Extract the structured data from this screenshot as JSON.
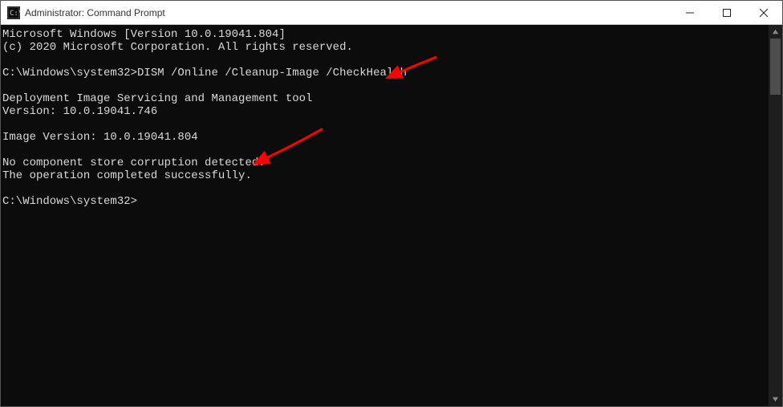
{
  "window": {
    "title": "Administrator: Command Prompt"
  },
  "terminal": {
    "lines": [
      "Microsoft Windows [Version 10.0.19041.804]",
      "(c) 2020 Microsoft Corporation. All rights reserved.",
      "",
      "C:\\Windows\\system32>DISM /Online /Cleanup-Image /CheckHealth",
      "",
      "Deployment Image Servicing and Management tool",
      "Version: 10.0.19041.746",
      "",
      "Image Version: 10.0.19041.804",
      "",
      "No component store corruption detected.",
      "The operation completed successfully.",
      "",
      "C:\\Windows\\system32>"
    ],
    "prompt": "C:\\Windows\\system32>",
    "command": "DISM /Online /Cleanup-Image /CheckHealth"
  },
  "annotations": {
    "arrow_color": "#ff0000"
  }
}
